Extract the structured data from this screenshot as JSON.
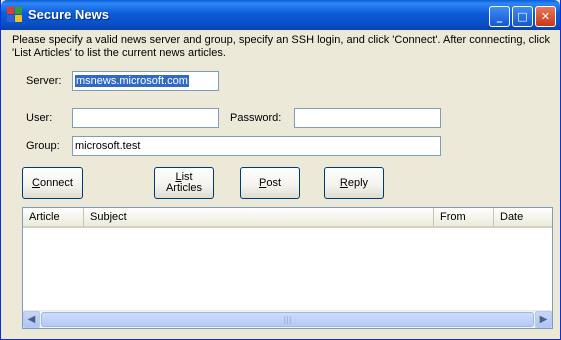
{
  "window": {
    "title": "Secure News",
    "controls": {
      "minimize": "_",
      "maximize": "□",
      "close": "✕"
    }
  },
  "instructions": "Please specify a valid news server and group, specify an SSH login, and click 'Connect'.  After connecting, click 'List Articles' to list the current news articles.",
  "form": {
    "server_label": "Server:",
    "server_value": "msnews.microsoft.com",
    "user_label": "User:",
    "user_value": "",
    "password_label": "Password:",
    "password_value": "",
    "group_label": "Group:",
    "group_value": "microsoft.test"
  },
  "buttons": {
    "connect": {
      "mnemonic": "C",
      "rest": "onnect"
    },
    "list_articles": {
      "line1_mnemonic": "L",
      "line1_rest": "ist",
      "line2": "Articles"
    },
    "post": {
      "mnemonic": "P",
      "rest": "ost"
    },
    "reply": {
      "mnemonic": "R",
      "rest": "eply"
    }
  },
  "articles_list": {
    "columns": [
      "Article",
      "Subject",
      "From",
      "Date"
    ],
    "rows": []
  },
  "scrollbar": {
    "left_arrow": "◀",
    "right_arrow": "▶",
    "grip": "|||"
  },
  "colors": {
    "titlebar": "#0a5fd6",
    "window_bg": "#ece9d8",
    "selection": "#316ac5"
  }
}
